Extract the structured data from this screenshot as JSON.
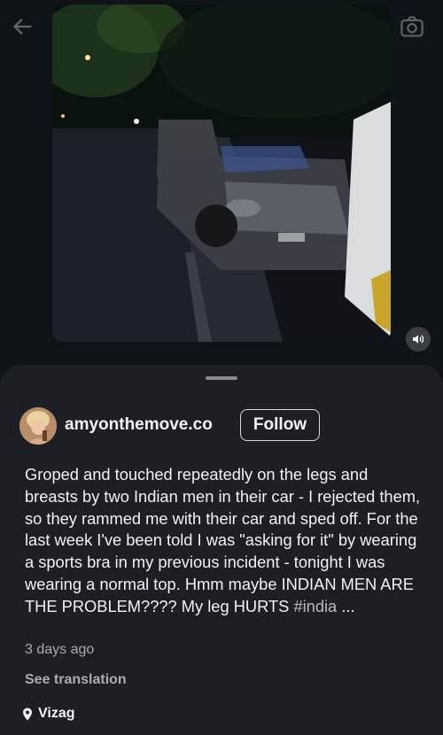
{
  "post": {
    "username": "amyonthemove.co",
    "follow_label": "Follow",
    "caption_text": "Groped and touched repeatedly on the legs and breasts by two Indian men in their car - I rejected them, so they rammed me with their car and sped off. For the last week I've been told I was \"asking for it\" by wearing a sports bra in my previous incident - tonight I was wearing a normal top. Hmm maybe INDIAN MEN ARE THE PROBLEM???? My leg HURTS ",
    "caption_hashtag": "#india",
    "caption_more": " ...",
    "timestamp": "3 days ago",
    "see_translation_label": "See translation",
    "location": "Vizag"
  },
  "icons": {
    "back": "arrow-left-icon",
    "camera": "camera-icon",
    "mute": "speaker-icon",
    "location": "location-pin-icon"
  },
  "colors": {
    "background": "#0f1419",
    "sheet": "#1c1f23",
    "muted_text": "#a9acb0"
  }
}
